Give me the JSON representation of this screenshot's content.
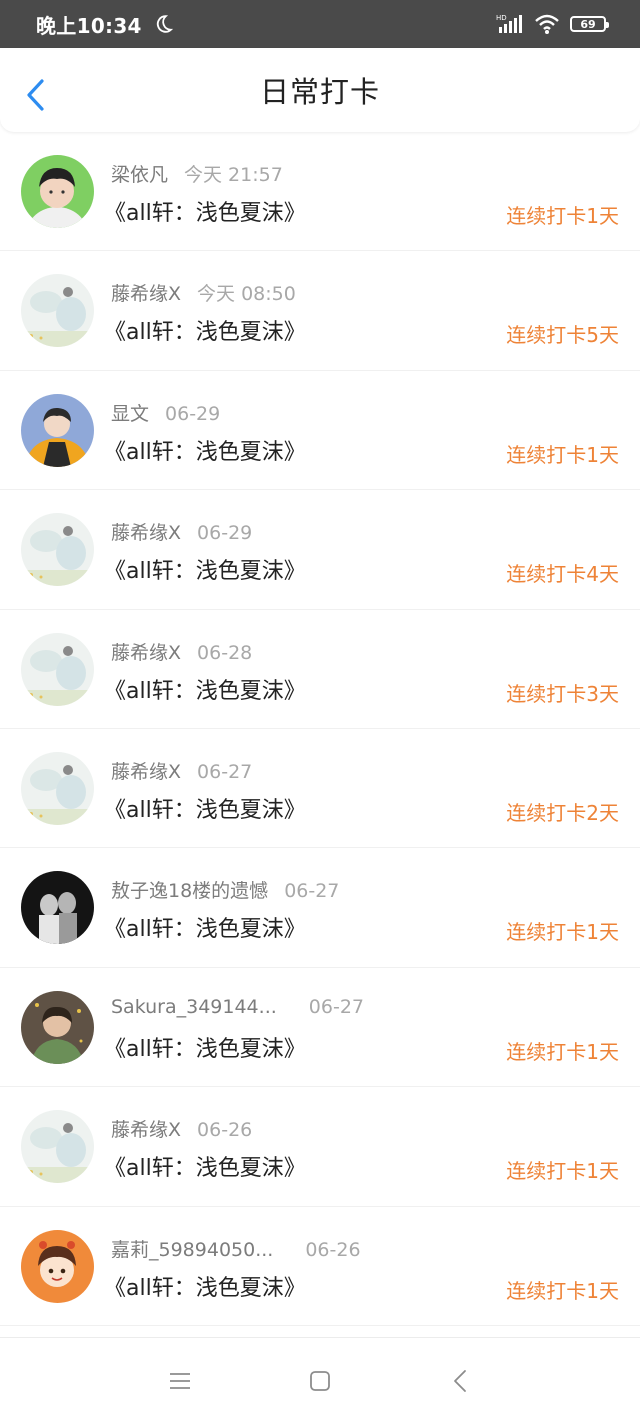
{
  "status_bar": {
    "time": "晚上10:34",
    "network": "HD",
    "battery": "69"
  },
  "header": {
    "title": "日常打卡"
  },
  "items": [
    {
      "name": "梁依凡",
      "time": "今天 21:57",
      "book": "《all轩：浅色夏沫》",
      "streak": "连续打卡1天",
      "avatar": "boy-photo"
    },
    {
      "name": "藤希缘X",
      "time": "今天 08:50",
      "book": "《all轩：浅色夏沫》",
      "streak": "连续打卡5天",
      "avatar": "pale-scene"
    },
    {
      "name": "显文",
      "time": "06-29",
      "book": "《all轩：浅色夏沫》",
      "streak": "连续打卡1天",
      "avatar": "jacket-photo"
    },
    {
      "name": "藤希缘X",
      "time": "06-29",
      "book": "《all轩：浅色夏沫》",
      "streak": "连续打卡4天",
      "avatar": "pale-scene"
    },
    {
      "name": "藤希缘X",
      "time": "06-28",
      "book": "《all轩：浅色夏沫》",
      "streak": "连续打卡3天",
      "avatar": "pale-scene"
    },
    {
      "name": "藤希缘X",
      "time": "06-27",
      "book": "《all轩：浅色夏沫》",
      "streak": "连续打卡2天",
      "avatar": "pale-scene"
    },
    {
      "name": "敖子逸18楼的遗憾",
      "time": "06-27",
      "book": "《all轩：浅色夏沫》",
      "streak": "连续打卡1天",
      "avatar": "dark-photo"
    },
    {
      "name": "Sakura_349144...",
      "time": "06-27",
      "book": "《all轩：浅色夏沫》",
      "streak": "连续打卡1天",
      "avatar": "sakura-photo"
    },
    {
      "name": "藤希缘X",
      "time": "06-26",
      "book": "《all轩：浅色夏沫》",
      "streak": "连续打卡1天",
      "avatar": "pale-scene"
    },
    {
      "name": "嘉莉_59894050...",
      "time": "06-26",
      "book": "《all轩：浅色夏沫》",
      "streak": "连续打卡1天",
      "avatar": "cartoon-girl"
    }
  ],
  "nav": {
    "icons": [
      "menu-icon",
      "home-square-icon",
      "back-triangle-icon"
    ]
  },
  "colors": {
    "accent": "#ee8337",
    "back_arrow": "#2d8cf0",
    "status_bar": "#4a4a4a"
  }
}
